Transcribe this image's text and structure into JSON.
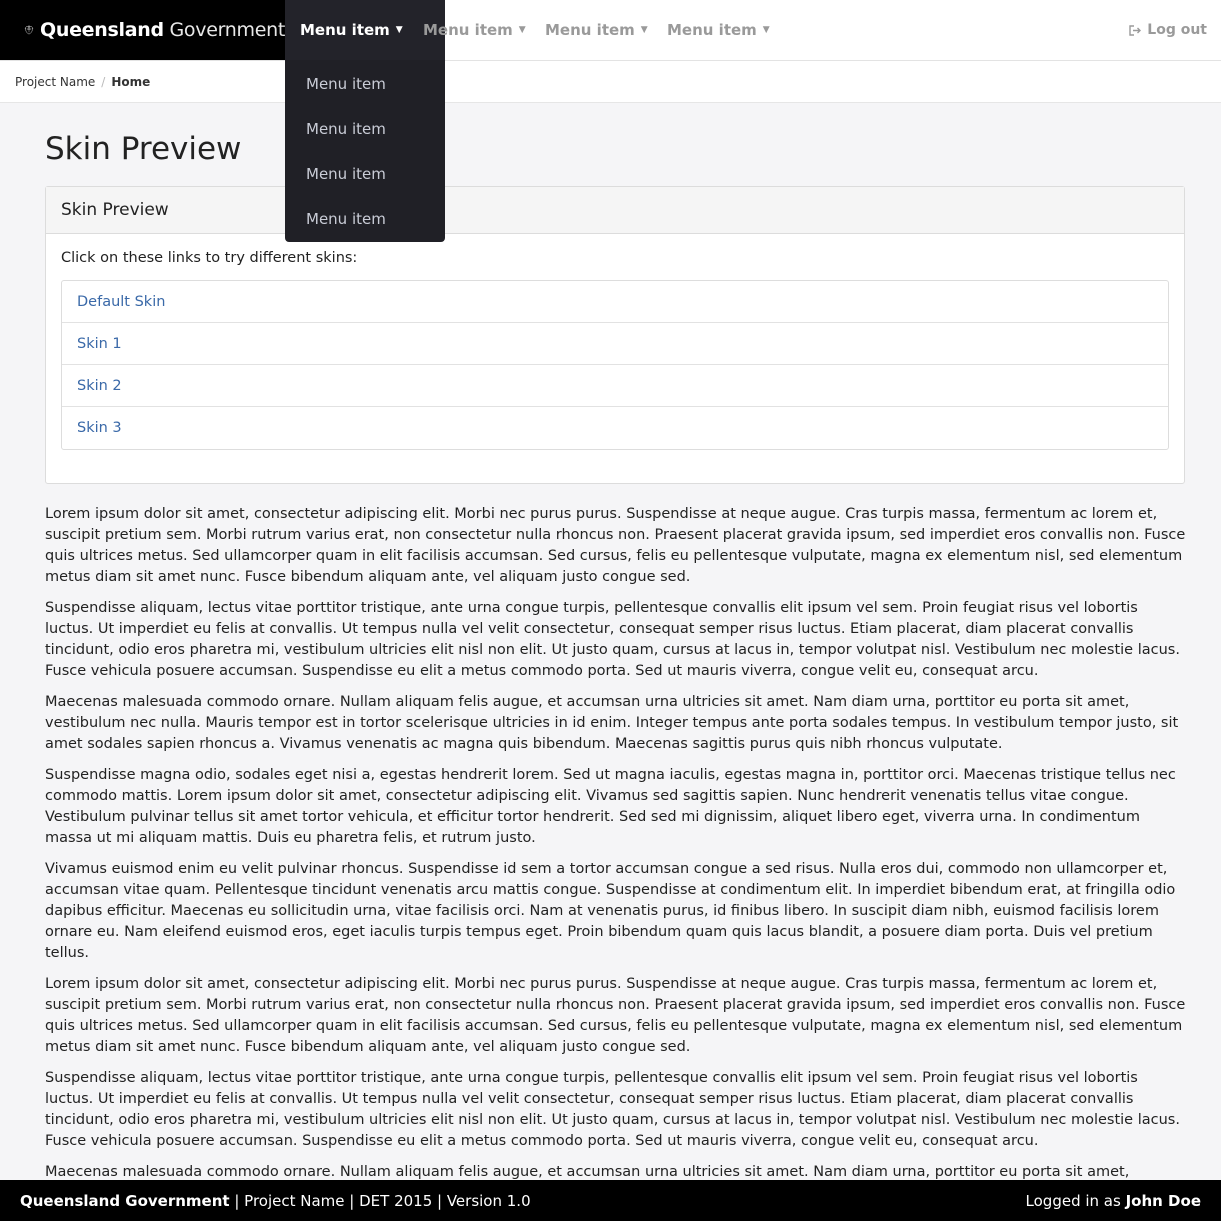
{
  "brand": {
    "bold": "Queensland",
    "light": "Government"
  },
  "nav": {
    "items": [
      {
        "label": "Menu item"
      },
      {
        "label": "Menu item"
      },
      {
        "label": "Menu item"
      },
      {
        "label": "Menu item"
      }
    ],
    "logout_label": "Log out"
  },
  "dropdown": {
    "items": [
      {
        "label": "Menu item"
      },
      {
        "label": "Menu item"
      },
      {
        "label": "Menu item"
      },
      {
        "label": "Menu item"
      }
    ]
  },
  "breadcrumb": {
    "items": [
      "Project Name",
      "Home"
    ]
  },
  "page_title": "Skin Preview",
  "panel": {
    "heading": "Skin Preview",
    "intro": "Click on these links to try different skins:",
    "links": [
      "Default Skin",
      "Skin 1",
      "Skin 2",
      "Skin 3"
    ]
  },
  "paragraphs": [
    "Lorem ipsum dolor sit amet, consectetur adipiscing elit. Morbi nec purus purus. Suspendisse at neque augue. Cras turpis massa, fermentum ac lorem et, suscipit pretium sem. Morbi rutrum varius erat, non consectetur nulla rhoncus non. Praesent placerat gravida ipsum, sed imperdiet eros convallis non. Fusce quis ultrices metus. Sed ullamcorper quam in elit facilisis accumsan. Sed cursus, felis eu pellentesque vulputate, magna ex elementum nisl, sed elementum metus diam sit amet nunc. Fusce bibendum aliquam ante, vel aliquam justo congue sed.",
    "Suspendisse aliquam, lectus vitae porttitor tristique, ante urna congue turpis, pellentesque convallis elit ipsum vel sem. Proin feugiat risus vel lobortis luctus. Ut imperdiet eu felis at convallis. Ut tempus nulla vel velit consectetur, consequat semper risus luctus. Etiam placerat, diam placerat convallis tincidunt, odio eros pharetra mi, vestibulum ultricies elit nisl non elit. Ut justo quam, cursus at lacus in, tempor volutpat nisl. Vestibulum nec molestie lacus. Fusce vehicula posuere accumsan. Suspendisse eu elit a metus commodo porta. Sed ut mauris viverra, congue velit eu, consequat arcu.",
    "Maecenas malesuada commodo ornare. Nullam aliquam felis augue, et accumsan urna ultricies sit amet. Nam diam urna, porttitor eu porta sit amet, vestibulum nec nulla. Mauris tempor est in tortor scelerisque ultricies in id enim. Integer tempus ante porta sodales tempus. In vestibulum tempor justo, sit amet sodales sapien rhoncus a. Vivamus venenatis ac magna quis bibendum. Maecenas sagittis purus quis nibh rhoncus vulputate.",
    "Suspendisse magna odio, sodales eget nisi a, egestas hendrerit lorem. Sed ut magna iaculis, egestas magna in, porttitor orci. Maecenas tristique tellus nec commodo mattis. Lorem ipsum dolor sit amet, consectetur adipiscing elit. Vivamus sed sagittis sapien. Nunc hendrerit venenatis tellus vitae congue. Vestibulum pulvinar tellus sit amet tortor vehicula, et efficitur tortor hendrerit. Sed sed mi dignissim, aliquet libero eget, viverra urna. In condimentum massa ut mi aliquam mattis. Duis eu pharetra felis, et rutrum justo.",
    "Vivamus euismod enim eu velit pulvinar rhoncus. Suspendisse id sem a tortor accumsan congue a sed risus. Nulla eros dui, commodo non ullamcorper et, accumsan vitae quam. Pellentesque tincidunt venenatis arcu mattis congue. Suspendisse at condimentum elit. In imperdiet bibendum erat, at fringilla odio dapibus efficitur. Maecenas eu sollicitudin urna, vitae facilisis orci. Nam at venenatis purus, id finibus libero. In suscipit diam nibh, euismod facilisis lorem ornare eu. Nam eleifend euismod eros, eget iaculis turpis tempus eget. Proin bibendum quam quis lacus blandit, a posuere diam porta. Duis vel pretium tellus.",
    "Lorem ipsum dolor sit amet, consectetur adipiscing elit. Morbi nec purus purus. Suspendisse at neque augue. Cras turpis massa, fermentum ac lorem et, suscipit pretium sem. Morbi rutrum varius erat, non consectetur nulla rhoncus non. Praesent placerat gravida ipsum, sed imperdiet eros convallis non. Fusce quis ultrices metus. Sed ullamcorper quam in elit facilisis accumsan. Sed cursus, felis eu pellentesque vulputate, magna ex elementum nisl, sed elementum metus diam sit amet nunc. Fusce bibendum aliquam ante, vel aliquam justo congue sed.",
    "Suspendisse aliquam, lectus vitae porttitor tristique, ante urna congue turpis, pellentesque convallis elit ipsum vel sem. Proin feugiat risus vel lobortis luctus. Ut imperdiet eu felis at convallis. Ut tempus nulla vel velit consectetur, consequat semper risus luctus. Etiam placerat, diam placerat convallis tincidunt, odio eros pharetra mi, vestibulum ultricies elit nisl non elit. Ut justo quam, cursus at lacus in, tempor volutpat nisl. Vestibulum nec molestie lacus. Fusce vehicula posuere accumsan. Suspendisse eu elit a metus commodo porta. Sed ut mauris viverra, congue velit eu, consequat arcu.",
    "Maecenas malesuada commodo ornare. Nullam aliquam felis augue, et accumsan urna ultricies sit amet. Nam diam urna, porttitor eu porta sit amet, vestibulum nec nulla. Mauris tempor est in tortor scelerisque ultricies in id enim. Integer tempus ante porta sodales tempus. In vestibulum tempor justo, sit amet sodales"
  ],
  "footer": {
    "left_bold": "Queensland Government",
    "left_rest": " | Project Name | DET 2015 | Version 1.0",
    "right_prefix": "Logged in as ",
    "right_user": "John Doe"
  },
  "icons": {
    "crest": "crest-logo",
    "caret": "caret-down-icon",
    "logout": "sign-out-icon"
  },
  "colors": {
    "brand_bg": "#000000",
    "active_nav_bg": "#23232a",
    "link": "#3a69a8",
    "footer_bg": "#000000"
  }
}
